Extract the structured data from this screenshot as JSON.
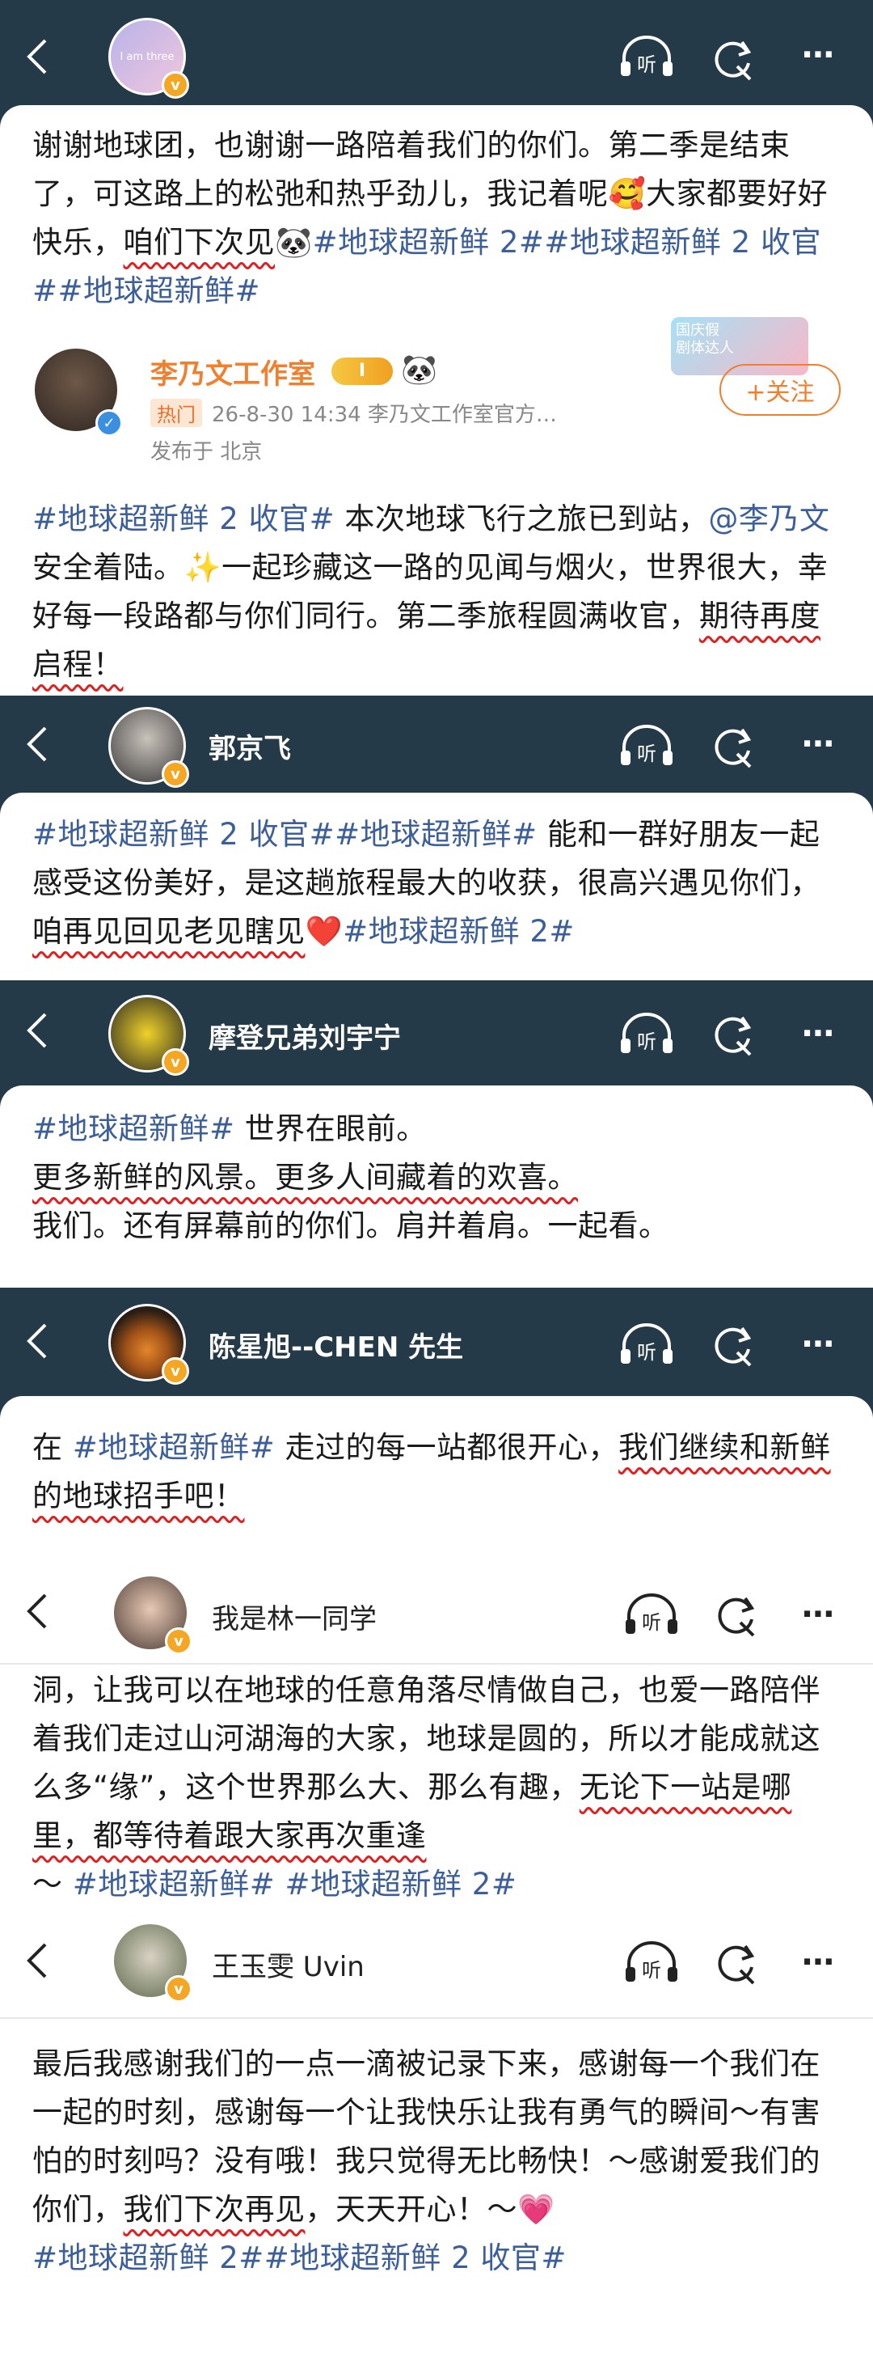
{
  "header_icons": {
    "listen": "听",
    "back": "back-chevron-icon",
    "refresh": "refresh-icon",
    "more": "⋯"
  },
  "post1": {
    "avatar_text": "I am three",
    "text_a": "谢谢地球团，也谢谢一路陪着我们的你们。第二季是结束了，可这路上的松弛和热乎劲儿，我记着呢",
    "emoji_a": "🥰",
    "text_b": "大家都要好好快乐，",
    "ul": "咱们下次见",
    "emoji_b": "🐼",
    "tags": "#地球超新鲜 2##地球超新鲜 2 收官##地球超新鲜#"
  },
  "studio": {
    "name": "李乃文工作室",
    "badge": "I",
    "panda": "🐼",
    "hot": "热门",
    "meta": "26-8-30 14:34  李乃文工作室官方…",
    "loc": "发布于 北京",
    "follow": "+关注",
    "sticker": "国庆假\n剧体达人"
  },
  "post2": {
    "tag": "#地球超新鲜 2 收官#",
    "a": " 本次地球飞行之旅已到站，",
    "at": "@李乃文",
    "b": " 安全着陆。",
    "spark": "✨",
    "c": "一起珍藏这一路的见闻与烟火，世界很大，幸好每一段路都与你们同行。第二季旅程圆满收官，",
    "ul": "期待再度启程！"
  },
  "user3": {
    "name": "郭京飞"
  },
  "post3": {
    "tag1": "#地球超新鲜 2 收官#",
    "tag2": "#地球超新鲜#",
    "a": "能和一群好朋友一起感受这份美好，是这趟旅程最大的收获，很高兴遇见你们，",
    "ul": "咱再见回见老见瞎见",
    "heart": "❤️",
    "tag3": "#地球超新鲜 2#"
  },
  "user4": {
    "name": "摩登兄弟刘宇宁"
  },
  "post4": {
    "tag": "#地球超新鲜#",
    "a": " 世界在眼前。",
    "ul": "更多新鲜的风景。更多人间藏着的欢喜。",
    "b": "我们。还有屏幕前的你们。肩并着肩。一起看。"
  },
  "user5": {
    "name": "陈星旭--CHEN 先生"
  },
  "post5": {
    "a": "在 ",
    "tag": "#地球超新鲜#",
    "b": " 走过的每一站都很开心，",
    "ul": "我们继续和新鲜的地球招手吧！"
  },
  "user6": {
    "name": "我是林一同学"
  },
  "post6": {
    "a": "洞，让我可以在地球的任意角落尽情做自己，也爱一路陪伴着我们走过山河湖海的大家，地球是圆的，所以才能成就这么多“缘”，这个世界那么大、那么有趣，",
    "ul": "无论下一站是哪里，都等待着跟大家再次重逢",
    "b": "～ ",
    "tags": "#地球超新鲜# #地球超新鲜 2#"
  },
  "user7": {
    "name": "王玉雯 Uvin"
  },
  "post7": {
    "a": "最后我感谢我们的一点一滴被记录下来，感谢每一个我们在一起的时刻，感谢每一个让我快乐让我有勇气的瞬间～有害怕的时刻吗？没有哦！我只觉得无比畅快！～感谢爱我们的你们，",
    "ul": "我们下次再见",
    "b": "，天天开心！～",
    "heart": "💗",
    "tags": "#地球超新鲜 2##地球超新鲜 2 收官#"
  }
}
